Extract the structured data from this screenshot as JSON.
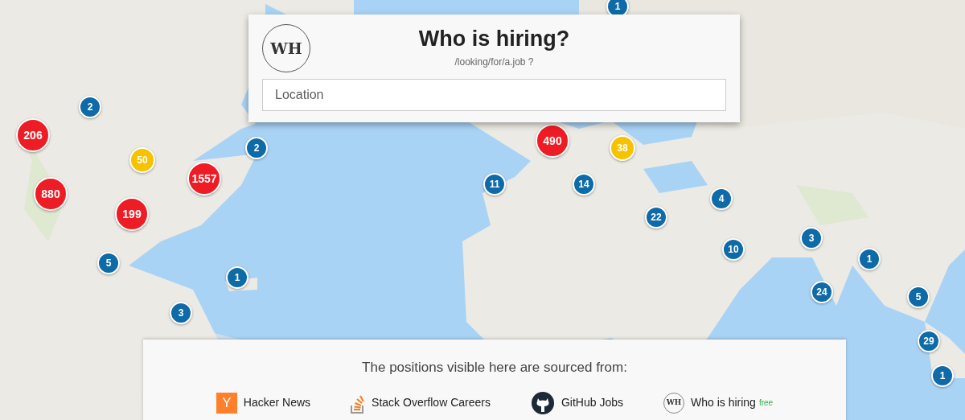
{
  "header": {
    "logo": "WH",
    "title": "Who is hiring?",
    "subtitle": "/looking/for/a.job ?",
    "search": {
      "placeholder": "Location"
    }
  },
  "map": {
    "kind": "picture",
    "markers": [
      {
        "count": "1",
        "color": "#0e6ba8"
      },
      {
        "count": "2",
        "color": "#0e6ba8"
      },
      {
        "count": "206",
        "color": "#ee1c24"
      },
      {
        "count": "2",
        "color": "#0e6ba8"
      },
      {
        "count": "490",
        "color": "#ee1c24"
      },
      {
        "count": "38",
        "color": "#f7c200"
      },
      {
        "count": "50",
        "color": "#f7c200"
      },
      {
        "count": "1557",
        "color": "#ee1c24"
      },
      {
        "count": "11",
        "color": "#0e6ba8"
      },
      {
        "count": "14",
        "color": "#0e6ba8"
      },
      {
        "count": "880",
        "color": "#ee1c24"
      },
      {
        "count": "4",
        "color": "#0e6ba8"
      },
      {
        "count": "199",
        "color": "#ee1c24"
      },
      {
        "count": "22",
        "color": "#0e6ba8"
      },
      {
        "count": "3",
        "color": "#0e6ba8"
      },
      {
        "count": "10",
        "color": "#0e6ba8"
      },
      {
        "count": "1",
        "color": "#0e6ba8"
      },
      {
        "count": "5",
        "color": "#0e6ba8"
      },
      {
        "count": "1",
        "color": "#0e6ba8"
      },
      {
        "count": "24",
        "color": "#0e6ba8"
      },
      {
        "count": "5",
        "color": "#0e6ba8"
      },
      {
        "count": "3",
        "color": "#0e6ba8"
      },
      {
        "count": "29",
        "color": "#0e6ba8"
      },
      {
        "count": "1",
        "color": "#0e6ba8"
      }
    ]
  },
  "sources": {
    "heading": "The positions visible here are sourced from:",
    "items": [
      {
        "kind": "hackernews",
        "logo": "Y",
        "name": "Hacker News"
      },
      {
        "kind": "stackoverflow",
        "name": "Stack Overflow Careers"
      },
      {
        "kind": "github",
        "name": "GitHub Jobs"
      },
      {
        "kind": "whoishiring",
        "logo": "WH",
        "name": "Who is hiring",
        "badge": "free"
      }
    ]
  }
}
